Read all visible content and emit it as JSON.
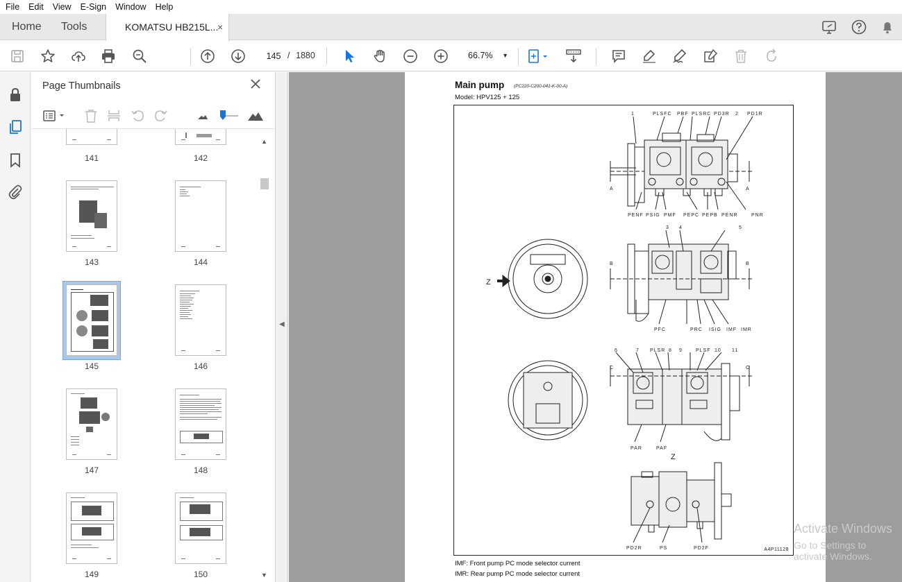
{
  "menu": [
    "File",
    "Edit",
    "View",
    "E-Sign",
    "Window",
    "Help"
  ],
  "tabs": {
    "home": "Home",
    "tools": "Tools",
    "document": "KOMATSU HB215L...",
    "close": "×"
  },
  "toolbar": {
    "page_current": "145",
    "page_sep": "/",
    "page_total": "1880",
    "zoom": "66.7%"
  },
  "thumbnail_panel": {
    "title": "Page Thumbnails",
    "close": "✕",
    "pages": [
      "141",
      "142",
      "143",
      "144",
      "145",
      "146",
      "147",
      "148",
      "149",
      "150"
    ],
    "selected": "145"
  },
  "document_page": {
    "title": "Main pump",
    "code": "(PC220-C200-041-K-00-A)",
    "model": "Model: HPV125 + 125",
    "figure_code": "A4P11128",
    "view_label_z": "Z",
    "labels_top": [
      "1",
      "PLSFC",
      "PBF",
      "PLSRC",
      "PD3R",
      "2",
      "PD1R"
    ],
    "labels_top_bottom": [
      "PENF",
      "PSIG",
      "PMF",
      "PEPC",
      "PEPB",
      "PENR",
      "PNR"
    ],
    "labels_mid": [
      "3",
      "4",
      "5"
    ],
    "labels_mid_bottom": [
      "PFC",
      "PRC",
      "ISIG",
      "IMF",
      "IMR"
    ],
    "labels_lower": [
      "6",
      "7",
      "PLSR",
      "8",
      "9",
      "PLSF",
      "10",
      "11"
    ],
    "labels_lower_bottom": [
      "PAR",
      "PAF"
    ],
    "labels_bottom": [
      "PD2R",
      "PS",
      "PD2F"
    ],
    "section_a": "A",
    "section_b": "B",
    "section_c": "C",
    "notes": [
      "IMF: Front pump PC mode selector current",
      "IMR: Rear pump PC mode selector current"
    ]
  },
  "watermark": {
    "line1": "Activate Windows",
    "line2": "Go to Settings to activate Windows."
  }
}
